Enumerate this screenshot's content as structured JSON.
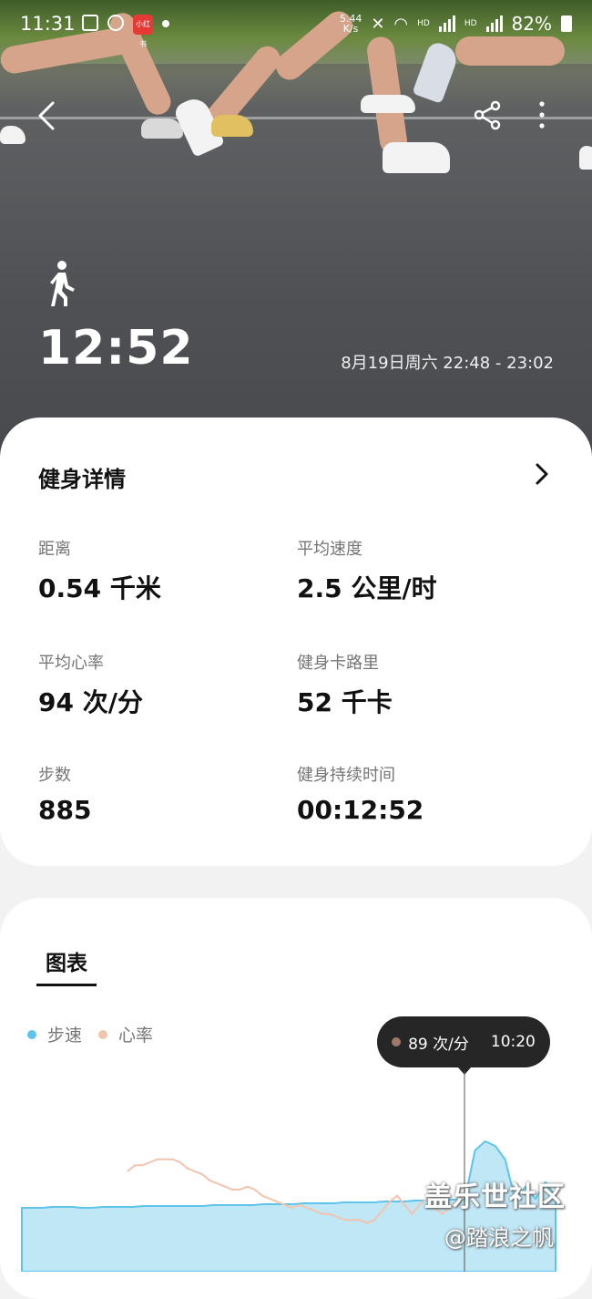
{
  "status_bar": {
    "time": "11:31",
    "net_speed_top": "5.44",
    "net_speed_unit": "K/s",
    "battery": "82%",
    "hd1": "HD",
    "hd2": "HD",
    "app_badge": "小红书"
  },
  "header": {
    "duration": "12:52",
    "date_range": "8月19日周六 22:48 - 23:02",
    "icons": [
      "back-icon",
      "share-icon",
      "more-icon",
      "walking-icon"
    ]
  },
  "details": {
    "title": "健身详情",
    "stats": [
      {
        "label": "距离",
        "value": "0.54 千米"
      },
      {
        "label": "平均速度",
        "value": "2.5 公里/时"
      },
      {
        "label": "平均心率",
        "value": "94 次/分"
      },
      {
        "label": "健身卡路里",
        "value": "52 千卡"
      },
      {
        "label": "步数",
        "value": "885"
      },
      {
        "label": "健身持续时间",
        "value": "00:12:52"
      }
    ]
  },
  "chart_section": {
    "tab": "图表",
    "legend": [
      {
        "name": "步速",
        "color": "#5ec4ea"
      },
      {
        "name": "心率",
        "color": "#f3c4ad"
      }
    ],
    "tooltip": {
      "value": "89 次/分",
      "time": "10:20"
    }
  },
  "chart_data": {
    "type": "area",
    "series": [
      {
        "name": "心率",
        "color": "#f3c4ad",
        "values": [
          96,
          98,
          98,
          99,
          100,
          100,
          100,
          99,
          97,
          96,
          95,
          93,
          92,
          91,
          90,
          90,
          91,
          90,
          88,
          87,
          86,
          85,
          84,
          85,
          84,
          83,
          82,
          82,
          81,
          80,
          80,
          80,
          79,
          80,
          83,
          86,
          88,
          85,
          82,
          85,
          87,
          84,
          82,
          84,
          86,
          89
        ]
      },
      {
        "name": "步速",
        "color": "#5ec4ea",
        "values": [
          2.2,
          2.2,
          2.2,
          2.3,
          2.3,
          2.3,
          2.2,
          2.2,
          2.3,
          2.3,
          2.3,
          2.3,
          2.4,
          2.4,
          2.4,
          2.4,
          2.4,
          2.4,
          2.4,
          2.5,
          2.5,
          2.5,
          2.5,
          2.5,
          2.6,
          2.6,
          2.6,
          2.6,
          2.7,
          2.7,
          2.7,
          2.7,
          2.8,
          2.8,
          2.8,
          2.8,
          2.9,
          2.9,
          2.9,
          3.0,
          3.0,
          3.0,
          3.1,
          3.1,
          3.1,
          8.5,
          9.5,
          9.0,
          7.5,
          3.0,
          4.5,
          3.2,
          5.0,
          3.5
        ]
      }
    ]
  },
  "watermark": {
    "line1": "盖乐世社区",
    "line2": "@踏浪之帆"
  },
  "colors": {
    "accent_dark": "#262626",
    "hr_color": "#f3c4ad",
    "pace_color": "#5ec4ea",
    "pace_fill": "#bfe7f6"
  }
}
